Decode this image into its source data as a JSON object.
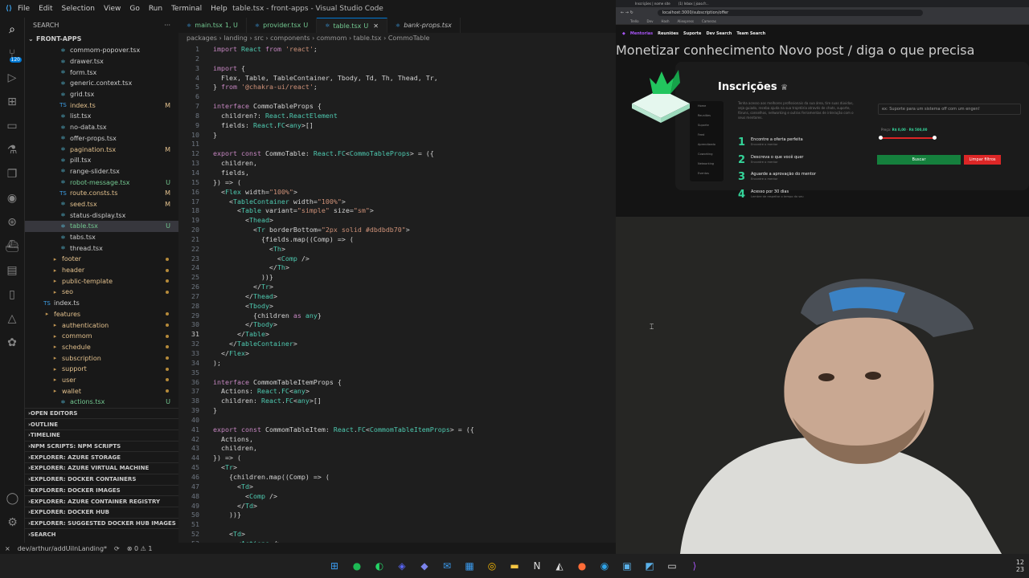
{
  "window": {
    "title": "table.tsx - front-apps - Visual Studio Code",
    "menus": [
      "File",
      "Edit",
      "Selection",
      "View",
      "Go",
      "Run",
      "Terminal",
      "Help"
    ]
  },
  "activity": {
    "scm_badge": "120"
  },
  "sidebar": {
    "header": "SEARCH",
    "root": "FRONT-APPS",
    "items": [
      {
        "label": "commom-popover.tsx",
        "marker": ""
      },
      {
        "label": "drawer.tsx",
        "marker": ""
      },
      {
        "label": "form.tsx",
        "marker": ""
      },
      {
        "label": "generic.context.tsx",
        "marker": ""
      },
      {
        "label": "grid.tsx",
        "marker": ""
      },
      {
        "label": "index.ts",
        "marker": "M"
      },
      {
        "label": "list.tsx",
        "marker": ""
      },
      {
        "label": "no-data.tsx",
        "marker": ""
      },
      {
        "label": "offer-props.tsx",
        "marker": ""
      },
      {
        "label": "pagination.tsx",
        "marker": "M"
      },
      {
        "label": "pill.tsx",
        "marker": ""
      },
      {
        "label": "range-slider.tsx",
        "marker": ""
      },
      {
        "label": "robot-message.tsx",
        "marker": "U"
      },
      {
        "label": "route.consts.ts",
        "marker": "M"
      },
      {
        "label": "seed.tsx",
        "marker": "M"
      },
      {
        "label": "status-display.tsx",
        "marker": ""
      },
      {
        "label": "table.tsx",
        "marker": "U"
      },
      {
        "label": "tabs.tsx",
        "marker": ""
      },
      {
        "label": "thread.tsx",
        "marker": ""
      },
      {
        "label": "footer",
        "marker": ""
      },
      {
        "label": "header",
        "marker": ""
      },
      {
        "label": "public-template",
        "marker": ""
      },
      {
        "label": "seo",
        "marker": ""
      },
      {
        "label": "index.ts",
        "marker": ""
      },
      {
        "label": "features",
        "marker": ""
      },
      {
        "label": "authentication",
        "marker": ""
      },
      {
        "label": "commom",
        "marker": ""
      },
      {
        "label": "schedule",
        "marker": ""
      },
      {
        "label": "subscription",
        "marker": ""
      },
      {
        "label": "support",
        "marker": ""
      },
      {
        "label": "user",
        "marker": ""
      },
      {
        "label": "wallet",
        "marker": ""
      },
      {
        "label": "actions.tsx",
        "marker": "U"
      }
    ],
    "sections": [
      "OPEN EDITORS",
      "OUTLINE",
      "TIMELINE",
      "NPM SCRIPTS: NPM SCRIPTS",
      "EXPLORER: AZURE STORAGE",
      "EXPLORER: AZURE VIRTUAL MACHINE",
      "EXPLORER: DOCKER CONTAINERS",
      "EXPLORER: DOCKER IMAGES",
      "EXPLORER: AZURE CONTAINER REGISTRY",
      "EXPLORER: DOCKER HUB",
      "EXPLORER: SUGGESTED DOCKER HUB IMAGES",
      "SEARCH"
    ]
  },
  "tabs": [
    {
      "label": "main.tsx",
      "status": "1, U"
    },
    {
      "label": "provider.tsx",
      "status": "U"
    },
    {
      "label": "table.tsx",
      "status": "U",
      "close": "✕"
    },
    {
      "label": "bank-props.tsx",
      "status": ""
    }
  ],
  "breadcrumb": "packages › landing › src › components › commom › table.tsx › CommoTable",
  "code": [
    "import React from 'react';",
    "",
    "import {",
    "  Flex, Table, TableContainer, Tbody, Td, Th, Thead, Tr,",
    "} from '@chakra-ui/react';",
    "",
    "interface CommoTableProps {",
    "  children?: React.ReactElement",
    "  fields: React.FC<any>[]",
    "}",
    "",
    "export const CommoTable: React.FC<CommoTableProps> = ({",
    "  children,",
    "  fields,",
    "}) => (",
    "  <Flex width=\"100%\">",
    "    <TableContainer width=\"100%\">",
    "      <Table variant=\"simple\" size=\"sm\">",
    "        <Thead>",
    "          <Tr borderBottom=\"2px solid #dbdbdb70\">",
    "            {fields.map((Comp) => (",
    "              <Th>",
    "                <Comp />",
    "              </Th>",
    "            ))}",
    "          </Tr>",
    "        </Thead>",
    "        <Tbody>",
    "          {children as any}",
    "        </Tbody>",
    "      </Table>",
    "    </TableContainer>",
    "  </Flex>",
    ");",
    "",
    "interface CommomTableItemProps {",
    "  Actions: React.FC<any>",
    "  children: React.FC<any>[]",
    "}",
    "",
    "export const CommomTableItem: React.FC<CommomTableItemProps> = ({",
    "  Actions,",
    "  children,",
    "}) => (",
    "  <Tr>",
    "    {children.map((Comp) => (",
    "      <Td>",
    "        <Comp />",
    "      </Td>",
    "    ))}",
    "",
    "    <Td>",
    "      <Actions />"
  ],
  "statusbar": {
    "branch": "dev/arthur/addUiInLanding*",
    "sync": "⟳",
    "problems": "⊗ 0 ⚠ 1"
  },
  "browser": {
    "tabs": [
      "Inscrições | nome site",
      "(1) Inbox | joao.fr..."
    ],
    "url": "localhost:3000/subscription/offer",
    "bookmarks": [
      "Trello",
      "Dev",
      "Hash",
      "Aliexpress",
      "Cameras"
    ],
    "nav": [
      "Mentorias",
      "Reuniões",
      "Suporte",
      "Dev Search",
      "Team Search"
    ],
    "cta_monetize": "Monetizar conhecimento",
    "cta_offer": "Novo post / diga o que precisa",
    "title": "Inscrições",
    "description": "Tenha acesso aos melhores profissionais da sua área, tire suas dúvidas, seja guiado, receba ajuda na sua trajetória através de chats, suporte, fóruns, conselhos, networking e outras ferramentas de interação com o seus mentores.",
    "menu": [
      "Home",
      "Reuniões",
      "Suporte",
      "Feed",
      "Aprendizado",
      "Coworking",
      "Networking",
      "Eventos"
    ],
    "steps": [
      {
        "n": "1",
        "title": "Encontre a oferta perfeita",
        "sub": "Encontre o mentor"
      },
      {
        "n": "2",
        "title": "Descreva o que você quer",
        "sub": "Encontre o mentor"
      },
      {
        "n": "3",
        "title": "Aguarde a aprovação do mentor",
        "sub": "Encontre o mentor"
      },
      {
        "n": "4",
        "title": "Acesso por 30 dias",
        "sub": "Lembre de respeitar o tempo do seu"
      }
    ],
    "search_placeholder": "ex: Suporte para um sistema off com um engen!",
    "price_label": "Preço:",
    "price_min": "R$ 0,00",
    "price_max": "R$ 500,00",
    "btn_search": "Buscar",
    "btn_clear": "Limpar filtros"
  },
  "clock": {
    "time": "12",
    "date": "23"
  },
  "colors": {
    "accent": "#0078d4",
    "brand": "#a855f7",
    "success": "#34d399",
    "danger": "#dc2626"
  }
}
